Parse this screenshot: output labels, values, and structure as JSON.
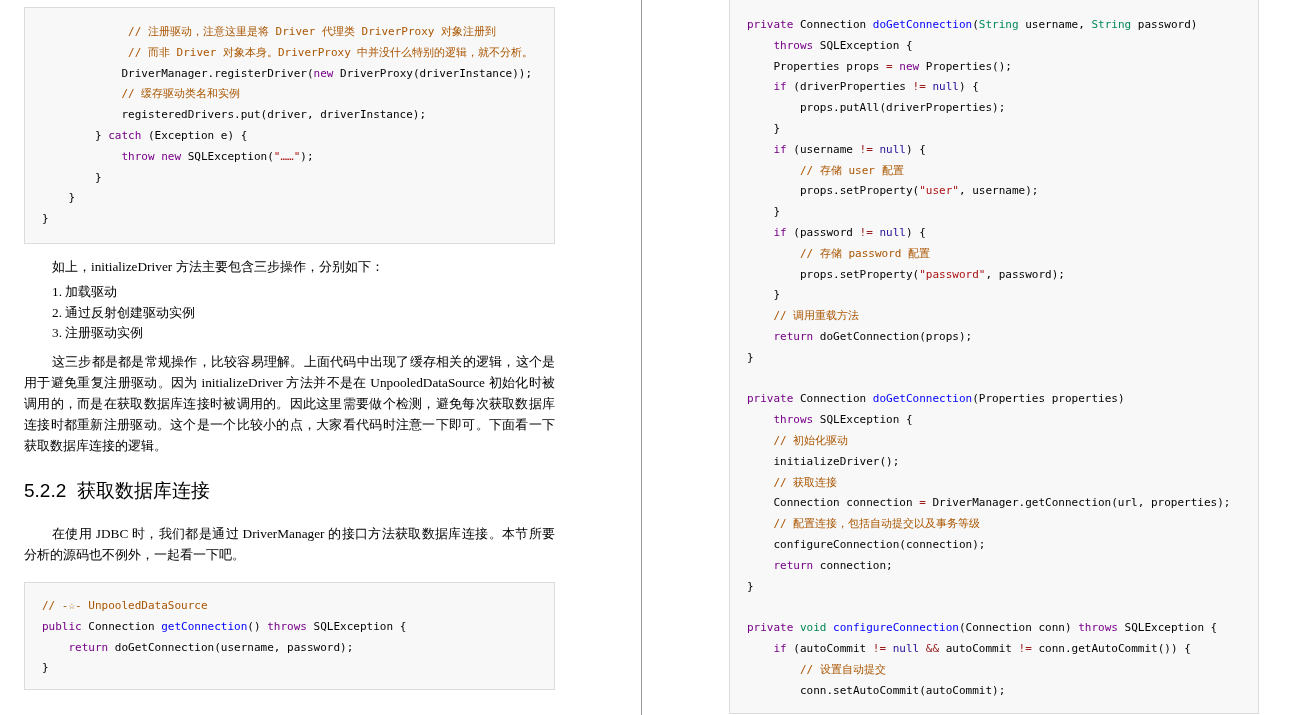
{
  "left_page": {
    "blocks": [
      {
        "kind": "code",
        "lines": [
          {
            "kind": "code",
            "tokens": [
              {
                "kind": "comment",
                "text": "             // 注册驱动，注意这里是将 Driver 代理类 DriverProxy 对象注册到"
              }
            ]
          },
          {
            "kind": "code",
            "tokens": [
              {
                "kind": "comment",
                "text": "             // 而非 Driver 对象本身。DriverProxy 中并没什么特别的逻辑，就不分析。"
              }
            ]
          },
          {
            "kind": "code",
            "tokens": [
              {
                "kind": "plain",
                "text": "            DriverManager.registerDriver("
              },
              {
                "kind": "keyword",
                "text": "new"
              },
              {
                "kind": "plain",
                "text": " DriverProxy(driverInstance));"
              }
            ]
          },
          {
            "kind": "code",
            "tokens": [
              {
                "kind": "comment",
                "text": "            // 缓存驱动类名和实例"
              }
            ]
          },
          {
            "kind": "code",
            "tokens": [
              {
                "kind": "plain",
                "text": "            registeredDrivers.put(driver, driverInstance);"
              }
            ]
          },
          {
            "kind": "code",
            "tokens": [
              {
                "kind": "plain",
                "text": "        } "
              },
              {
                "kind": "keyword",
                "text": "catch"
              },
              {
                "kind": "plain",
                "text": " (Exception e) {"
              }
            ]
          },
          {
            "kind": "code",
            "tokens": [
              {
                "kind": "keyword",
                "text": "            throw new"
              },
              {
                "kind": "plain",
                "text": " SQLException("
              },
              {
                "kind": "string",
                "text": "\"……\""
              },
              {
                "kind": "plain",
                "text": ");"
              }
            ]
          },
          {
            "kind": "code",
            "tokens": [
              {
                "kind": "plain",
                "text": "        }"
              }
            ]
          },
          {
            "kind": "code",
            "tokens": [
              {
                "kind": "plain",
                "text": "    }"
              }
            ]
          },
          {
            "kind": "code",
            "tokens": [
              {
                "kind": "plain",
                "text": "}"
              }
            ]
          }
        ]
      },
      {
        "kind": "paragraph",
        "text": "如上，initializeDriver 方法主要包含三步操作，分别如下："
      },
      {
        "kind": "list",
        "items": [
          "1. 加载驱动",
          "2. 通过反射创建驱动实例",
          "3. 注册驱动实例"
        ]
      },
      {
        "kind": "paragraph",
        "text": "这三步都是都是常规操作，比较容易理解。上面代码中出现了缓存相关的逻辑，这个是用于避免重复注册驱动。因为 initializeDriver 方法并不是在 UnpooledDataSource 初始化时被调用的，而是在获取数据库连接时被调用的。因此这里需要做个检测，避免每次获取数据库连接时都重新注册驱动。这个是一个比较小的点，大家看代码时注意一下即可。下面看一下获取数据库连接的逻辑。"
      },
      {
        "kind": "heading",
        "text": "5.2.2  获取数据库连接"
      },
      {
        "kind": "paragraph",
        "text": "在使用 JDBC 时，我们都是通过 DriverManager 的接口方法获取数据库连接。本节所要分析的源码也不例外，一起看一下吧。"
      },
      {
        "kind": "code",
        "lines": [
          {
            "kind": "code",
            "tokens": [
              {
                "kind": "comment",
                "text": "// -☆- UnpooledDataSource"
              }
            ]
          },
          {
            "kind": "code",
            "tokens": [
              {
                "kind": "keyword",
                "text": "public"
              },
              {
                "kind": "plain",
                "text": " Connection "
              },
              {
                "kind": "function",
                "text": "getConnection"
              },
              {
                "kind": "plain",
                "text": "() "
              },
              {
                "kind": "keyword",
                "text": "throws"
              },
              {
                "kind": "plain",
                "text": " SQLException {"
              }
            ]
          },
          {
            "kind": "code",
            "tokens": [
              {
                "kind": "keyword",
                "text": "    return"
              },
              {
                "kind": "plain",
                "text": " doGetConnection(username, password);"
              }
            ]
          },
          {
            "kind": "code",
            "tokens": [
              {
                "kind": "plain",
                "text": "}"
              }
            ]
          }
        ]
      }
    ]
  },
  "right_page": {
    "blocks": [
      {
        "kind": "code",
        "lines": [
          {
            "kind": "code",
            "tokens": [
              {
                "kind": "keyword",
                "text": "private"
              },
              {
                "kind": "plain",
                "text": " Connection "
              },
              {
                "kind": "function",
                "text": "doGetConnection"
              },
              {
                "kind": "plain",
                "text": "("
              },
              {
                "kind": "type",
                "text": "String"
              },
              {
                "kind": "plain",
                "text": " username, "
              },
              {
                "kind": "type",
                "text": "String"
              },
              {
                "kind": "plain",
                "text": " password)"
              }
            ]
          },
          {
            "kind": "code",
            "tokens": [
              {
                "kind": "keyword",
                "text": "    throws"
              },
              {
                "kind": "plain",
                "text": " SQLException {"
              }
            ]
          },
          {
            "kind": "code",
            "tokens": [
              {
                "kind": "plain",
                "text": "    Properties props "
              },
              {
                "kind": "operator",
                "text": "="
              },
              {
                "kind": "keyword",
                "text": " new"
              },
              {
                "kind": "plain",
                "text": " Properties();"
              }
            ]
          },
          {
            "kind": "code",
            "tokens": [
              {
                "kind": "keyword",
                "text": "    if"
              },
              {
                "kind": "plain",
                "text": " (driverProperties "
              },
              {
                "kind": "operator",
                "text": "!="
              },
              {
                "kind": "literal",
                "text": " null"
              },
              {
                "kind": "plain",
                "text": ") {"
              }
            ]
          },
          {
            "kind": "code",
            "tokens": [
              {
                "kind": "plain",
                "text": "        props.putAll(driverProperties);"
              }
            ]
          },
          {
            "kind": "code",
            "tokens": [
              {
                "kind": "plain",
                "text": "    }"
              }
            ]
          },
          {
            "kind": "code",
            "tokens": [
              {
                "kind": "keyword",
                "text": "    if"
              },
              {
                "kind": "plain",
                "text": " (username "
              },
              {
                "kind": "operator",
                "text": "!="
              },
              {
                "kind": "literal",
                "text": " null"
              },
              {
                "kind": "plain",
                "text": ") {"
              }
            ]
          },
          {
            "kind": "code",
            "tokens": [
              {
                "kind": "comment",
                "text": "        // 存储 user 配置"
              }
            ]
          },
          {
            "kind": "code",
            "tokens": [
              {
                "kind": "plain",
                "text": "        props.setProperty("
              },
              {
                "kind": "string",
                "text": "\"user\""
              },
              {
                "kind": "plain",
                "text": ", username);"
              }
            ]
          },
          {
            "kind": "code",
            "tokens": [
              {
                "kind": "plain",
                "text": "    }"
              }
            ]
          },
          {
            "kind": "code",
            "tokens": [
              {
                "kind": "keyword",
                "text": "    if"
              },
              {
                "kind": "plain",
                "text": " (password "
              },
              {
                "kind": "operator",
                "text": "!="
              },
              {
                "kind": "literal",
                "text": " null"
              },
              {
                "kind": "plain",
                "text": ") {"
              }
            ]
          },
          {
            "kind": "code",
            "tokens": [
              {
                "kind": "comment",
                "text": "        // 存储 password 配置"
              }
            ]
          },
          {
            "kind": "code",
            "tokens": [
              {
                "kind": "plain",
                "text": "        props.setProperty("
              },
              {
                "kind": "string",
                "text": "\"password\""
              },
              {
                "kind": "plain",
                "text": ", password);"
              }
            ]
          },
          {
            "kind": "code",
            "tokens": [
              {
                "kind": "plain",
                "text": "    }"
              }
            ]
          },
          {
            "kind": "code",
            "tokens": [
              {
                "kind": "comment",
                "text": "    // 调用重载方法"
              }
            ]
          },
          {
            "kind": "code",
            "tokens": [
              {
                "kind": "keyword",
                "text": "    return"
              },
              {
                "kind": "plain",
                "text": " doGetConnection(props);"
              }
            ]
          },
          {
            "kind": "code",
            "tokens": [
              {
                "kind": "plain",
                "text": "}"
              }
            ]
          },
          {
            "kind": "blank"
          },
          {
            "kind": "code",
            "tokens": [
              {
                "kind": "keyword",
                "text": "private"
              },
              {
                "kind": "plain",
                "text": " Connection "
              },
              {
                "kind": "function",
                "text": "doGetConnection"
              },
              {
                "kind": "plain",
                "text": "(Properties properties)"
              }
            ]
          },
          {
            "kind": "code",
            "tokens": [
              {
                "kind": "keyword",
                "text": "    throws"
              },
              {
                "kind": "plain",
                "text": " SQLException {"
              }
            ]
          },
          {
            "kind": "code",
            "tokens": [
              {
                "kind": "comment",
                "text": "    // 初始化驱动"
              }
            ]
          },
          {
            "kind": "code",
            "tokens": [
              {
                "kind": "plain",
                "text": "    initializeDriver();"
              }
            ]
          },
          {
            "kind": "code",
            "tokens": [
              {
                "kind": "comment",
                "text": "    // 获取连接"
              }
            ]
          },
          {
            "kind": "code",
            "tokens": [
              {
                "kind": "plain",
                "text": "    Connection connection "
              },
              {
                "kind": "operator",
                "text": "="
              },
              {
                "kind": "plain",
                "text": " DriverManager.getConnection(url, properties);"
              }
            ]
          },
          {
            "kind": "code",
            "tokens": [
              {
                "kind": "comment",
                "text": "    // 配置连接，包括自动提交以及事务等级"
              }
            ]
          },
          {
            "kind": "code",
            "tokens": [
              {
                "kind": "plain",
                "text": "    configureConnection(connection);"
              }
            ]
          },
          {
            "kind": "code",
            "tokens": [
              {
                "kind": "keyword",
                "text": "    return"
              },
              {
                "kind": "plain",
                "text": " connection;"
              }
            ]
          },
          {
            "kind": "code",
            "tokens": [
              {
                "kind": "plain",
                "text": "}"
              }
            ]
          },
          {
            "kind": "blank"
          },
          {
            "kind": "code",
            "tokens": [
              {
                "kind": "keyword",
                "text": "private"
              },
              {
                "kind": "type",
                "text": " void"
              },
              {
                "kind": "function",
                "text": " configureConnection"
              },
              {
                "kind": "plain",
                "text": "(Connection conn) "
              },
              {
                "kind": "keyword",
                "text": "throws"
              },
              {
                "kind": "plain",
                "text": " SQLException {"
              }
            ]
          },
          {
            "kind": "code",
            "tokens": [
              {
                "kind": "keyword",
                "text": "    if"
              },
              {
                "kind": "plain",
                "text": " (autoCommit "
              },
              {
                "kind": "operator",
                "text": "!="
              },
              {
                "kind": "literal",
                "text": " null"
              },
              {
                "kind": "operator",
                "text": " &&"
              },
              {
                "kind": "plain",
                "text": " autoCommit "
              },
              {
                "kind": "operator",
                "text": "!="
              },
              {
                "kind": "plain",
                "text": " conn.getAutoCommit()) {"
              }
            ]
          },
          {
            "kind": "code",
            "tokens": [
              {
                "kind": "comment",
                "text": "        // 设置自动提交"
              }
            ]
          },
          {
            "kind": "code",
            "tokens": [
              {
                "kind": "plain",
                "text": "        conn.setAutoCommit(autoCommit);"
              }
            ]
          }
        ]
      }
    ]
  }
}
